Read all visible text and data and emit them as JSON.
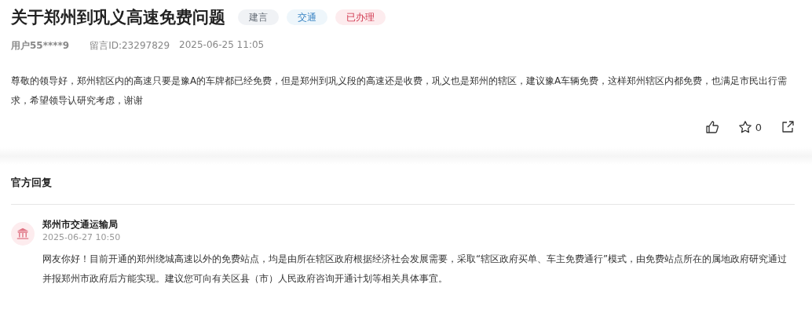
{
  "title": "关于郑州到巩义高速免费问题",
  "tags": [
    {
      "label": "建言",
      "color": "#f0f2f5"
    },
    {
      "label": "交通",
      "color": "#eef6fb"
    },
    {
      "label": "已办理",
      "color": "#fdecee"
    }
  ],
  "meta": {
    "user": "用户55****9",
    "message_id": "留言ID:23297829",
    "time": "2025-06-25 11:05"
  },
  "content": "尊敬的领导好，郑州辖区内的高速只要是豫A的车牌都已经免费，但是郑州到巩义段的高速还是收费，巩义也是郑州的辖区，建议豫A车辆免费，这样郑州辖区内都免费，也满足市民出行需求，希望领导认研究考虑，谢谢",
  "actions": {
    "favorites": "0"
  },
  "reply_section": {
    "heading": "官方回复",
    "reply": {
      "author": "郑州市交通运输局",
      "time": "2025-06-27 10:50",
      "text": "网友你好！目前开通的郑州绕城高速以外的免费站点，均是由所在辖区政府根据经济社会发展需要，采取“辖区政府买单、车主免费通行”模式，由免费站点所在的属地政府研究通过并报郑州市政府后方能实现。建议您可向有关区县（市）人民政府咨询开通计划等相关具体事宜。"
    }
  }
}
